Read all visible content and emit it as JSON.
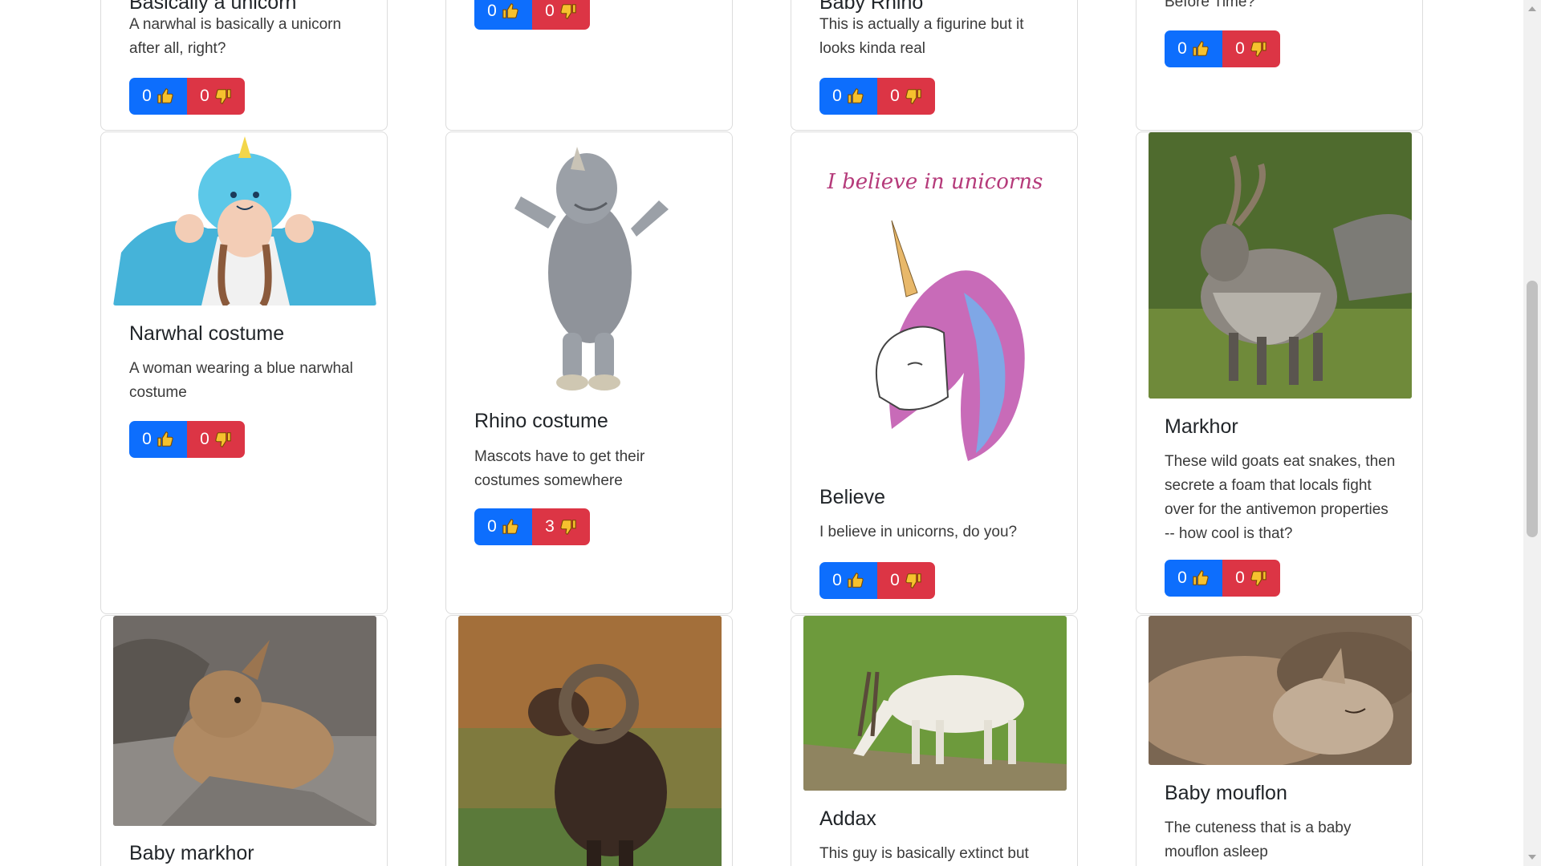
{
  "colors": {
    "upvote": "#0d6efd",
    "downvote": "#dc3545",
    "thumb": "#f6c12e"
  },
  "top_row": [
    {
      "title": "Basically a unicorn",
      "description": "A narwhal is basically a unicorn after all, right?",
      "up": "0",
      "down": "0"
    },
    {
      "title": "",
      "description": "",
      "up": "0",
      "down": "0"
    },
    {
      "title": "Baby Rhino",
      "description": "This is actually a figurine but it looks kinda real",
      "up": "0",
      "down": "0"
    },
    {
      "title": "",
      "description": "Before Time?",
      "up": "0",
      "down": "0"
    }
  ],
  "middle_row": [
    {
      "image": "woman-in-blue-narwhal-costume",
      "title": "Narwhal costume",
      "description": "A woman wearing a blue narwhal costume",
      "up": "0",
      "down": "0"
    },
    {
      "image": "grey-rhino-mascot",
      "title": "Rhino costume",
      "description": "Mascots have to get their costumes somewhere",
      "up": "0",
      "down": "3"
    },
    {
      "image": "unicorn-watercolor-believe",
      "image_text": "I believe in unicorns",
      "title": "Believe",
      "description": "I believe in unicorns, do you?",
      "up": "0",
      "down": "0"
    },
    {
      "image": "markhor-goat",
      "title": "Markhor",
      "description": "These wild goats eat snakes, then secrete a foam that locals fight over for the antivemon properties -- how cool is that?",
      "up": "0",
      "down": "0"
    }
  ],
  "bottom_row": [
    {
      "image": "baby-markhor-on-rock",
      "title": "Baby markhor"
    },
    {
      "image": "mouflon-ram"
    },
    {
      "image": "addax-grazing",
      "title": "Addax",
      "description": "This guy is basically extinct but"
    },
    {
      "image": "baby-mouflon-sleeping",
      "title": "Baby mouflon",
      "description": "The cuteness that is a baby mouflon asleep"
    }
  ]
}
